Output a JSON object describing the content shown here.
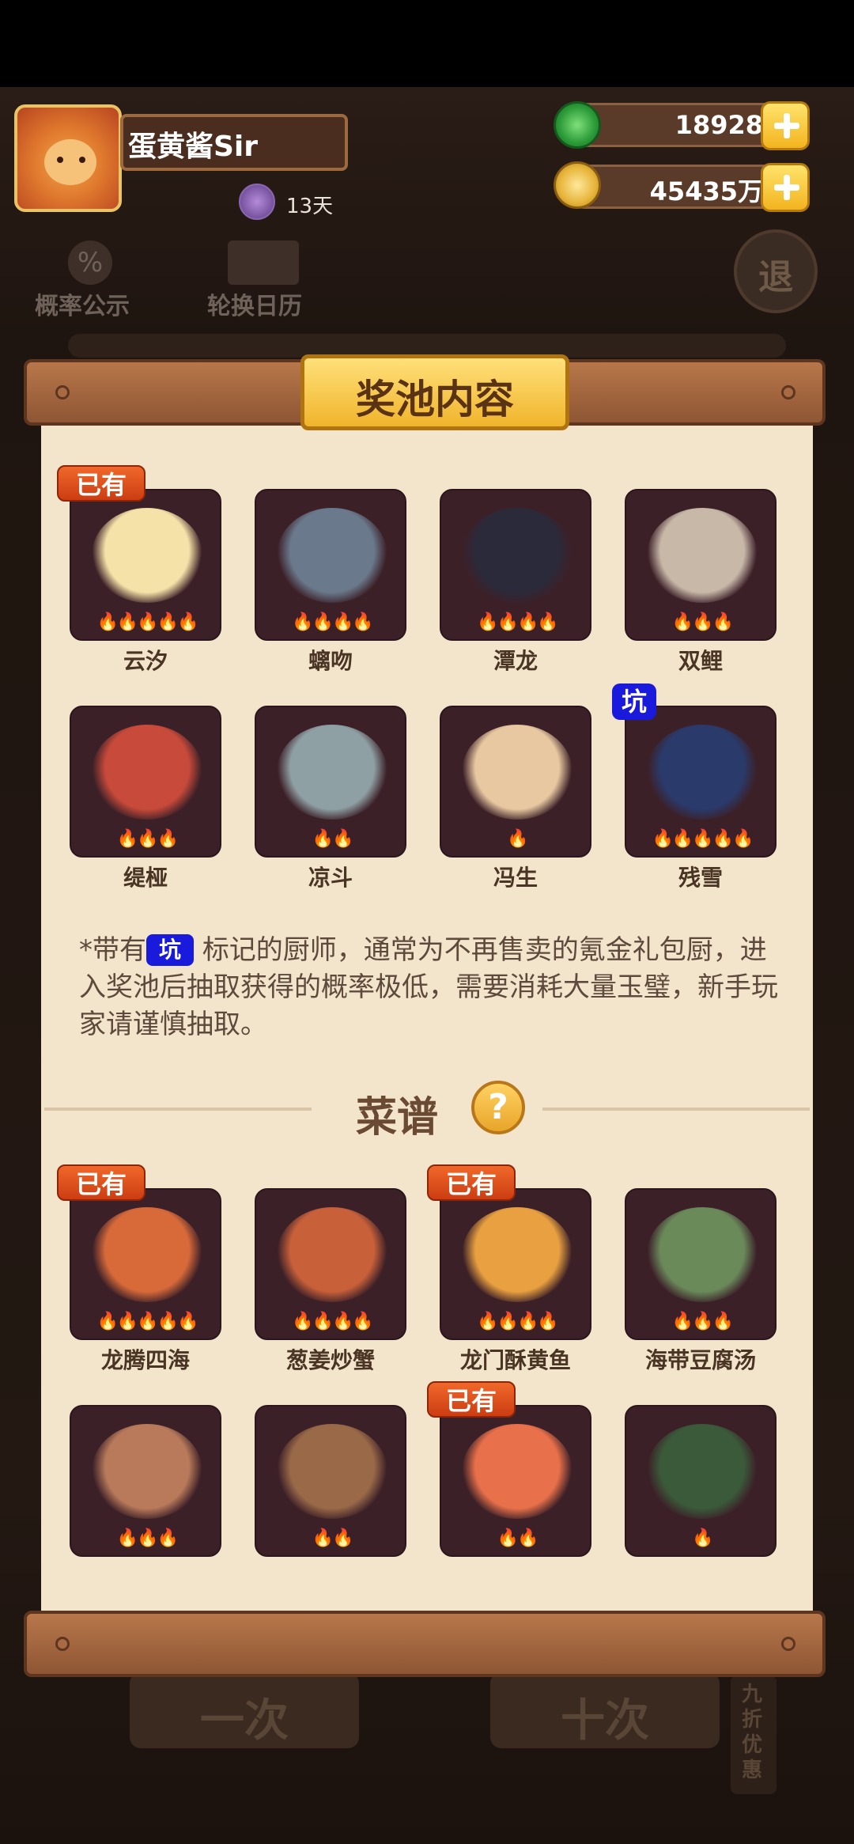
{
  "player": {
    "nickname": "蛋黄酱Sir",
    "days": "13天"
  },
  "currencies": {
    "jade": "18928",
    "coins": "45435万"
  },
  "background_menu": {
    "odds": "概率公示",
    "calendar": "轮换日历",
    "exit": "退",
    "bottom_left": "一次",
    "bottom_right": "十次",
    "discount": "九折优惠"
  },
  "panel": {
    "title": "奖池内容",
    "owned_label": "已有",
    "pit_label": "坑",
    "note_prefix": "*带有",
    "note_suffix": "标记的厨师，通常为不再售卖的氪金礼包厨，进入奖池后抽取获得的概率极低，需要消耗大量玉璧，新手玩家请谨慎抽取。",
    "recipes_title": "菜谱",
    "help_symbol": "?"
  },
  "chefs": [
    {
      "name": "云汐",
      "stars": 5,
      "owned": true,
      "pit": false,
      "color": "#f5e2a8"
    },
    {
      "name": "螭吻",
      "stars": 4,
      "owned": false,
      "pit": false,
      "color": "#6a7a8c"
    },
    {
      "name": "潭龙",
      "stars": 4,
      "owned": false,
      "pit": false,
      "color": "#2b2a3a"
    },
    {
      "name": "双鲤",
      "stars": 3,
      "owned": false,
      "pit": false,
      "color": "#c8b8a8"
    },
    {
      "name": "缇桠",
      "stars": 3,
      "owned": false,
      "pit": false,
      "color": "#c84a3a"
    },
    {
      "name": "凉斗",
      "stars": 2,
      "owned": false,
      "pit": false,
      "color": "#8ea0a4"
    },
    {
      "name": "冯生",
      "stars": 1,
      "owned": false,
      "pit": false,
      "color": "#e8c8a0"
    },
    {
      "name": "残雪",
      "stars": 5,
      "owned": false,
      "pit": true,
      "color": "#2a3a6a"
    }
  ],
  "recipes": [
    {
      "name": "龙腾四海",
      "stars": 5,
      "owned": true,
      "color": "#d86a3a"
    },
    {
      "name": "葱姜炒蟹",
      "stars": 4,
      "owned": false,
      "color": "#c8603a"
    },
    {
      "name": "龙门酥黄鱼",
      "stars": 4,
      "owned": true,
      "color": "#e8a040"
    },
    {
      "name": "海带豆腐汤",
      "stars": 3,
      "owned": false,
      "color": "#6a8a5a"
    },
    {
      "name": "",
      "stars": 3,
      "owned": false,
      "color": "#b87a5a"
    },
    {
      "name": "",
      "stars": 2,
      "owned": false,
      "color": "#9a6a48"
    },
    {
      "name": "",
      "stars": 2,
      "owned": true,
      "color": "#e8704a"
    },
    {
      "name": "",
      "stars": 1,
      "owned": false,
      "color": "#3a5a3a"
    }
  ],
  "colors": {
    "panel_bg": "#f3e4cc",
    "card_bg": "#3c2028",
    "owned_tag": "#e0521e",
    "pit_tag": "#1a1adc",
    "plaque": "#f6c94a"
  }
}
